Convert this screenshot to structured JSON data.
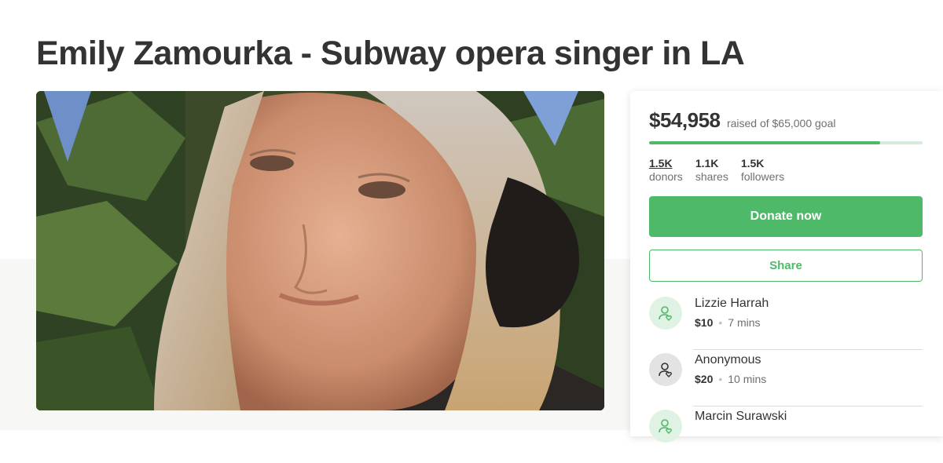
{
  "campaign": {
    "title": "Emily Zamourka - Subway opera singer in LA"
  },
  "fundraiser": {
    "raised": "$54,958",
    "goal_text": "raised of $65,000 goal",
    "progress_fraction": 0.8455
  },
  "stats": [
    {
      "value": "1.5K",
      "label": "donors"
    },
    {
      "value": "1.1K",
      "label": "shares"
    },
    {
      "value": "1.5K",
      "label": "followers"
    }
  ],
  "actions": {
    "donate_label": "Donate now",
    "share_label": "Share"
  },
  "donations": [
    {
      "name": "Lizzie Harrah",
      "amount": "$10",
      "time": "7 mins"
    },
    {
      "name": "Anonymous",
      "amount": "$20",
      "time": "10 mins"
    },
    {
      "name": "Marcin Surawski",
      "amount": "",
      "time": ""
    }
  ],
  "colors": {
    "brand_green": "#4fb96a",
    "text_dark": "#333333",
    "text_muted": "#6f6f6f"
  },
  "icons": {
    "donor_avatar": "user-heart-icon"
  }
}
